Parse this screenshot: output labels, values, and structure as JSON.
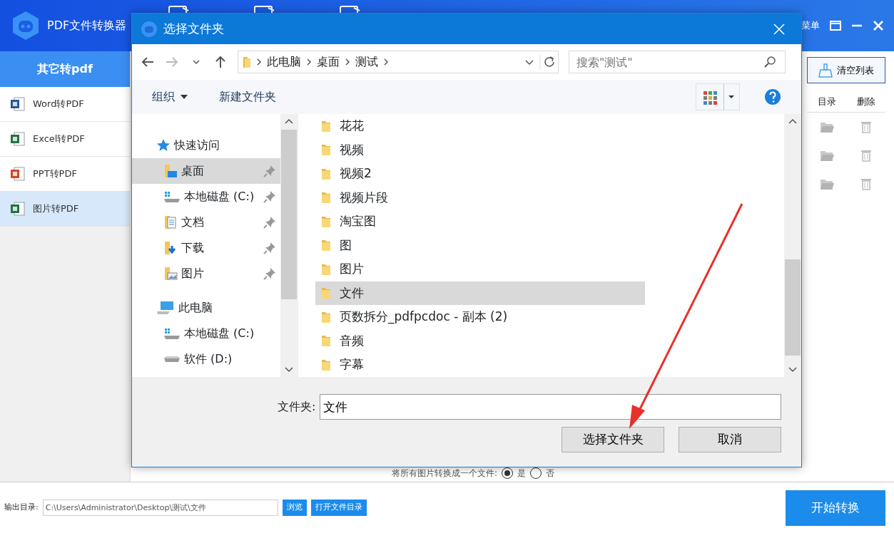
{
  "app": {
    "title": "PDF文件转换器",
    "menu_label": "菜单",
    "category": "其它转pdf",
    "nav": [
      {
        "label": "Word转PDF",
        "kind": "word",
        "selected": false
      },
      {
        "label": "Excel转PDF",
        "kind": "excel",
        "selected": false
      },
      {
        "label": "PPT转PDF",
        "kind": "ppt",
        "selected": false
      },
      {
        "label": "图片转PDF",
        "kind": "image",
        "selected": true
      }
    ],
    "clear_button": "清空列表",
    "table": {
      "columns": [
        "目录",
        "删除"
      ],
      "rows": [
        {
          "kind": "file"
        },
        {
          "kind": "file"
        },
        {
          "kind": "file"
        }
      ]
    },
    "merge_option": {
      "label": "将所有图片转换成一个文件:",
      "options": [
        {
          "label": "是",
          "selected": true
        },
        {
          "label": "否",
          "selected": false
        }
      ]
    },
    "output": {
      "label": "输出目录:",
      "path": "C:\\Users\\Administrator\\Desktop\\测试\\文件",
      "browse": "浏览",
      "open_folder": "打开文件目录"
    },
    "start_button": "开始转换"
  },
  "dialog": {
    "title": "选择文件夹",
    "breadcrumb": [
      "此电脑",
      "桌面",
      "测试"
    ],
    "search_placeholder": "搜索\"测试\"",
    "toolbar": {
      "organize": "组织",
      "new_folder": "新建文件夹"
    },
    "tree": [
      {
        "label": "快速访问",
        "kind": "star",
        "children": [
          {
            "label": "桌面",
            "kind": "desktop",
            "pinned": true,
            "selected": true
          },
          {
            "label": "本地磁盘 (C:)",
            "kind": "windrive",
            "pinned": true,
            "selected": false
          },
          {
            "label": "文档",
            "kind": "docs",
            "pinned": true,
            "selected": false
          },
          {
            "label": "下载",
            "kind": "download",
            "pinned": true,
            "selected": false
          },
          {
            "label": "图片",
            "kind": "pictures",
            "pinned": true,
            "selected": false
          }
        ]
      },
      {
        "label": "此电脑",
        "kind": "pc",
        "children": [
          {
            "label": "本地磁盘 (C:)",
            "kind": "windrive",
            "pinned": false,
            "selected": false
          },
          {
            "label": "软件 (D:)",
            "kind": "drive",
            "pinned": false,
            "selected": false
          }
        ]
      }
    ],
    "folders": [
      {
        "name": "花花",
        "selected": false
      },
      {
        "name": "视频",
        "selected": false
      },
      {
        "name": "视频2",
        "selected": false
      },
      {
        "name": "视频片段",
        "selected": false
      },
      {
        "name": "淘宝图",
        "selected": false
      },
      {
        "name": "图",
        "selected": false
      },
      {
        "name": "图片",
        "selected": false
      },
      {
        "name": "文件",
        "selected": true
      },
      {
        "name": "页数拆分_pdfpcdoc - 副本 (2)",
        "selected": false
      },
      {
        "name": "音频",
        "selected": false
      },
      {
        "name": "字幕",
        "selected": false
      }
    ],
    "folder_label": "文件夹:",
    "folder_value": "文件",
    "confirm_button": "选择文件夹",
    "cancel_button": "取消"
  }
}
